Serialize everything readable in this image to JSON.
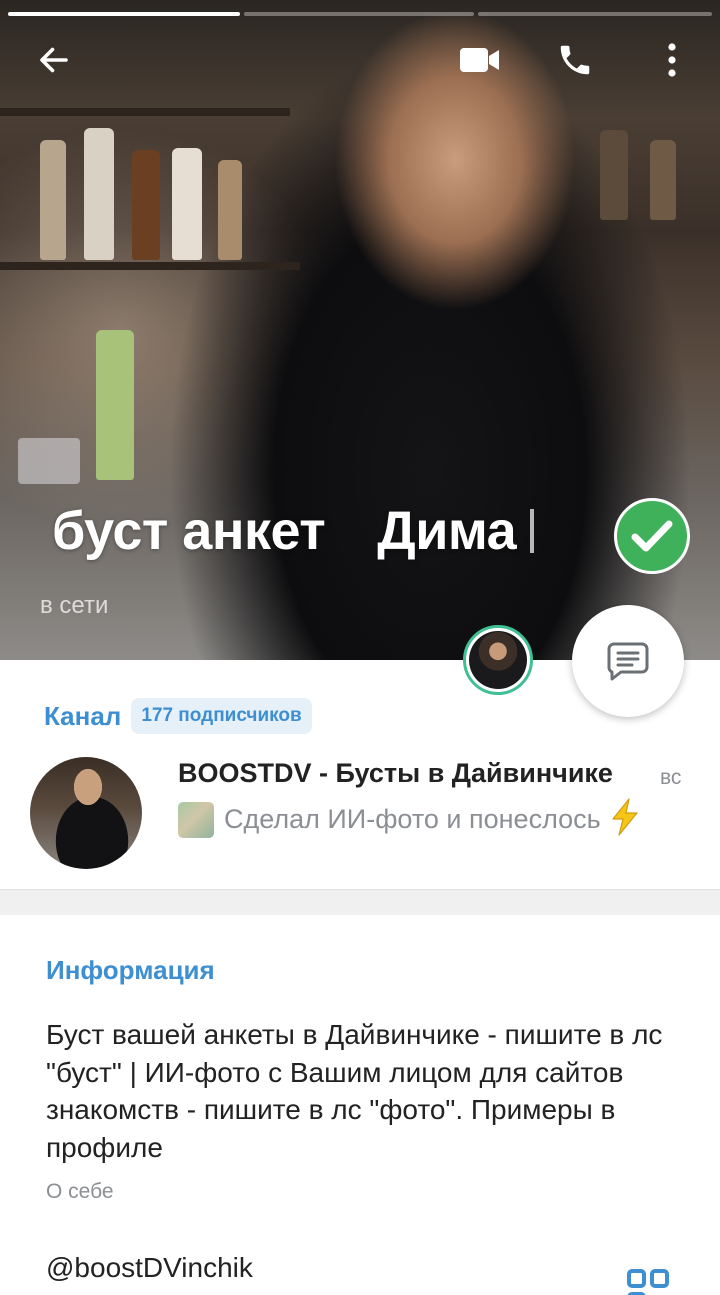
{
  "header": {
    "story_progress_segments": 3,
    "active_segment": 0,
    "back_icon": "arrow-left-icon",
    "video_call_icon": "video-camera-icon",
    "call_icon": "phone-icon",
    "menu_icon": "more-vertical-icon"
  },
  "profile": {
    "name_part1": "буст анкет",
    "name_part2": "Дима",
    "verified_icon": "verified-check-icon",
    "status": "в сети",
    "message_icon": "message-icon"
  },
  "channel": {
    "label": "Канал",
    "subscribers": "177 подписчиков",
    "title": "BOOSTDV - Бусты в Дайвинчике",
    "date": "вс",
    "last_message": "Сделал ИИ-фото и понеслось"
  },
  "info": {
    "title": "Информация",
    "bio": "Буст вашей анкеты в Дайвинчике - пишите в лс \"буст\" | ИИ-фото с Вашим лицом для сайтов знакомств - пишите в лс \"фото\". Примеры в профиле",
    "bio_label": "О себе",
    "username": "@boostDVinchik",
    "qr_icon": "qr-code-icon"
  },
  "colors": {
    "accent": "#3d8fd1",
    "verified": "#3fb15a",
    "story_ring": "#3fc093",
    "muted_text": "#8b8f94"
  }
}
